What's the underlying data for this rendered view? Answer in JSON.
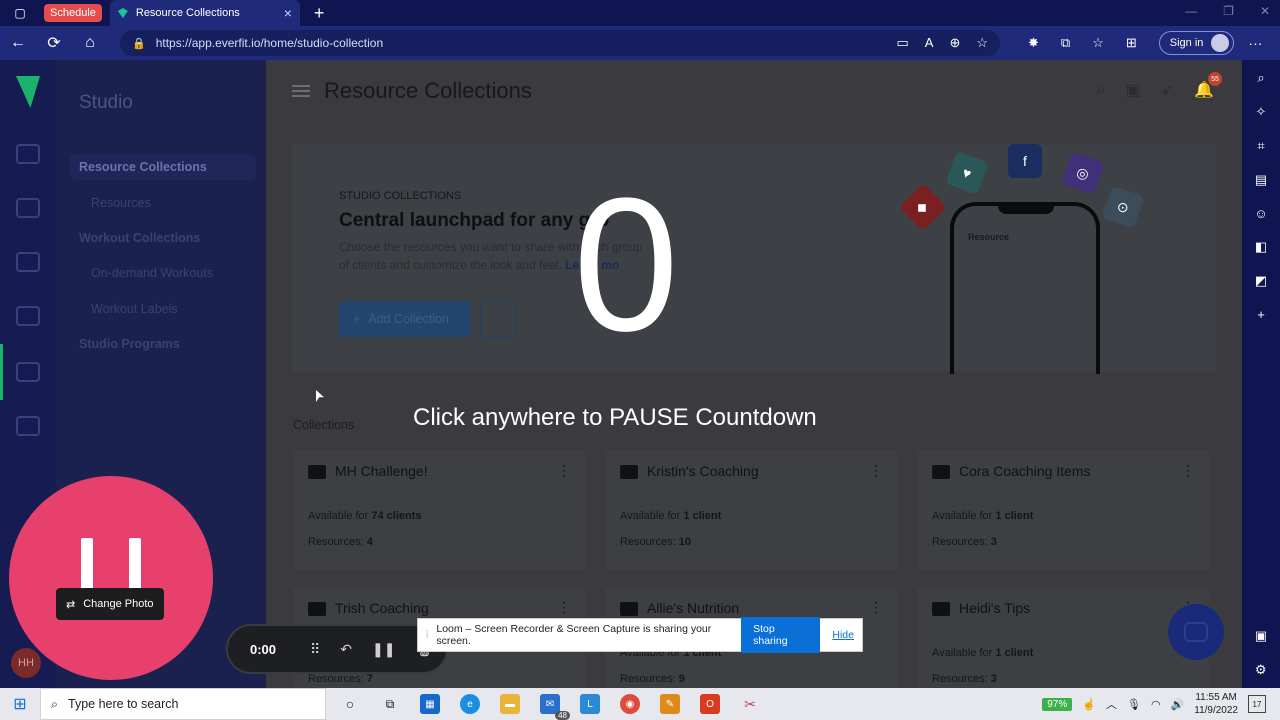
{
  "browser": {
    "schedule_pill": "Schedule",
    "tab_title": "Resource Collections",
    "url": "https://app.everfit.io/home/studio-collection",
    "signin": "Sign in"
  },
  "sidebar": {
    "heading": "Studio",
    "items": [
      {
        "label": "Resource Collections"
      },
      {
        "label": "Resources"
      },
      {
        "label": "Workout Collections"
      },
      {
        "label": "On-demand Workouts"
      },
      {
        "label": "Workout Labels"
      },
      {
        "label": "Studio Programs"
      }
    ]
  },
  "header": {
    "title": "Resource Collections",
    "notification_count": "55"
  },
  "banner": {
    "eyebrow": "STUDIO COLLECTIONS",
    "headline": "Central launchpad for any gro",
    "desc_line1": "Choose the resources you want to share with each group",
    "desc_line2": "of clients and customize the look and feel. ",
    "learn_more": "Learn mo",
    "add_button": "Add Collection",
    "phone_label": "Resource"
  },
  "collections": {
    "label": "Collections",
    "cards": [
      {
        "name": "MH Challenge!",
        "avail_prefix": "Available for ",
        "avail_value": "74 clients",
        "res_prefix": "Resources: ",
        "res_value": "4"
      },
      {
        "name": "Kristin's Coaching",
        "avail_prefix": "Available for ",
        "avail_value": "1 client",
        "res_prefix": "Resources: ",
        "res_value": "10"
      },
      {
        "name": "Cora Coaching Items",
        "avail_prefix": "Available for ",
        "avail_value": "1 client",
        "res_prefix": "Resources: ",
        "res_value": "3"
      },
      {
        "name": "Trish Coaching",
        "avail_prefix": "",
        "avail_value": "",
        "res_prefix": "Resources: ",
        "res_value": "7"
      },
      {
        "name": "Allie's Nutrition",
        "avail_prefix": "Available for ",
        "avail_value": "1 client",
        "res_prefix": "Resources: ",
        "res_value": "9"
      },
      {
        "name": "Heidi's Tips",
        "avail_prefix": "Available for ",
        "avail_value": "1 client",
        "res_prefix": "Resources: ",
        "res_value": "3"
      }
    ]
  },
  "overlay": {
    "countdown": "0",
    "pause_text": "Click anywhere to PAUSE Countdown"
  },
  "loom": {
    "change_photo": "Change Photo",
    "avatar_initials": "HH",
    "timer": "0:00",
    "share_text": "Loom – Screen Recorder & Screen Capture is sharing your screen.",
    "stop_sharing": "Stop sharing",
    "hide": "Hide"
  },
  "taskbar": {
    "search_placeholder": "Type here to search",
    "mail_badge": "48",
    "battery": "97%",
    "time": "11:55 AM",
    "date": "11/9/2022",
    "notif_count": "17"
  }
}
